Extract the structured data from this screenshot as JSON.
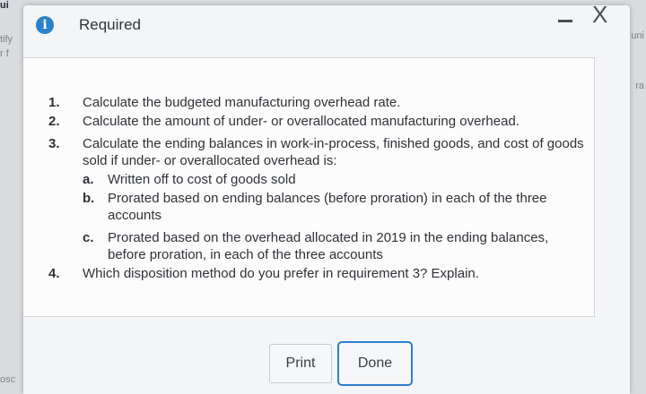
{
  "background": {
    "fragments": [
      "ui",
      "tify",
      "r f",
      "uni",
      "ra",
      "osc"
    ]
  },
  "dialog": {
    "icon": "info-icon",
    "title": "Required",
    "minimize_label": "-",
    "close_label": "X"
  },
  "requirements": [
    {
      "num": "1.",
      "text": "Calculate the budgeted manufacturing overhead rate."
    },
    {
      "num": "2.",
      "text": "Calculate the amount of under- or overallocated manufacturing overhead."
    },
    {
      "num": "3.",
      "text": "Calculate the ending balances in work-in-process, finished goods, and cost of goods sold if under- or overallocated overhead is:",
      "subitems": [
        {
          "letter": "a.",
          "text": "Written off to cost of goods sold"
        },
        {
          "letter": "b.",
          "text": "Prorated based on ending balances (before proration) in each of the three accounts"
        },
        {
          "letter": "c.",
          "text": "Prorated based on the overhead allocated in 2019 in the ending balances, before proration, in each of the three accounts"
        }
      ]
    },
    {
      "num": "4.",
      "text": "Which disposition method do you prefer in requirement 3? Explain."
    }
  ],
  "buttons": {
    "print": "Print",
    "done": "Done"
  },
  "colors": {
    "accent": "#2c7fd0",
    "info_icon": "#2a82c9"
  }
}
